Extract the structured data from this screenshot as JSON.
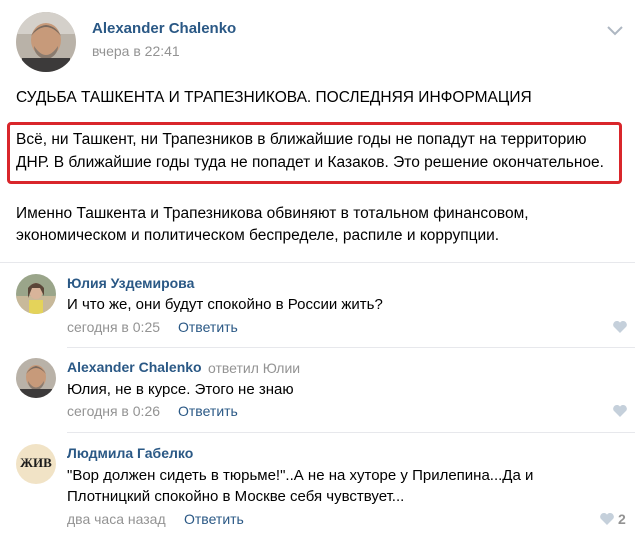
{
  "post": {
    "author": "Alexander Chalenko",
    "time": "вчера в 22:41",
    "title": "СУДЬБА ТАШКЕНТА И ТРАПЕЗНИКОВА. ПОСЛЕДНЯЯ ИНФОРМАЦИЯ",
    "highlight_line1": "Всё, ни Ташкент, ни Трапезников в ближайшие годы не попадут на территорию",
    "highlight_line2": "ДНР. В ближайшие годы туда не попадет и Казаков. Это решение окончательное.",
    "para_line1": "Именно Ташкента и Трапезникова обвиняют в тотальном финансовом,",
    "para_line2": "экономическом и политическом беспределе, распиле и коррупции.",
    "highlight_border_color": "#d9262b",
    "menu_icon": "chevron-down-icon"
  },
  "comments": [
    {
      "author": "Юлия Уздемирова",
      "reply_to": "",
      "text_line1": "И что же, они будут спокойно в России жить?",
      "text_line2": "",
      "time": "сегодня в 0:25",
      "reply_label": "Ответить",
      "likes": ""
    },
    {
      "author": "Alexander Chalenko",
      "reply_to": "ответил Юлии",
      "text_line1": "Юлия, не в курсе. Этого не знаю",
      "text_line2": "",
      "time": "сегодня в 0:26",
      "reply_label": "Ответить",
      "likes": ""
    },
    {
      "author": "Людмила Габелко",
      "reply_to": "",
      "text_line1": "\"Вор должен сидеть в тюрьме!\"..А не на хуторе у Прилепина...Да и",
      "text_line2": "Плотницкий спокойно в Москве себя чувствует...",
      "time": "два часа назад",
      "reply_label": "Ответить",
      "likes": "2",
      "avatar_text": "ЖИВ"
    }
  ],
  "colors": {
    "link": "#2a5885",
    "muted": "#939393",
    "heart": "#c5d0db"
  }
}
